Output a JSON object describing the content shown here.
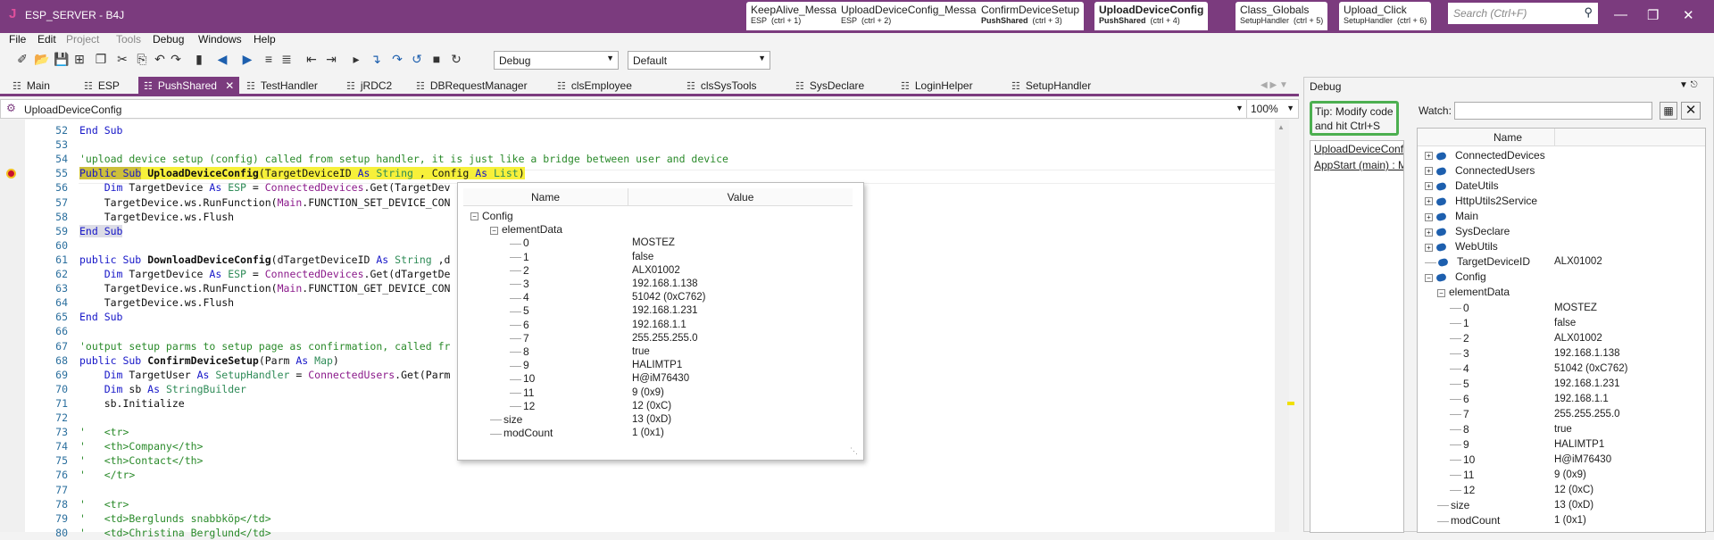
{
  "window": {
    "logo": "J",
    "title": "ESP_SERVER - B4J",
    "search_placeholder": "Search (Ctrl+F)"
  },
  "quick_tabs": [
    {
      "name": "KeepAlive_Message",
      "module": "ESP",
      "shortcut": "(ctrl + 1)"
    },
    {
      "name": "UploadDeviceConfig_Message",
      "module": "ESP",
      "shortcut": "(ctrl + 2)"
    },
    {
      "name": "ConfirmDeviceSetup",
      "module": "PushShared",
      "shortcut": "(ctrl + 3)"
    },
    {
      "name": "UploadDeviceConfig",
      "module": "PushShared",
      "shortcut": "(ctrl + 4)",
      "active": true
    },
    {
      "name": "Class_Globals",
      "module": "SetupHandler",
      "shortcut": "(ctrl + 5)"
    },
    {
      "name": "Upload_Click",
      "module": "SetupHandler",
      "shortcut": "(ctrl + 6)"
    }
  ],
  "menu": [
    "File",
    "Edit",
    "Project",
    "Tools",
    "Debug",
    "Windows",
    "Help"
  ],
  "toolbar": {
    "build_config": "Debug",
    "target": "Default"
  },
  "tabs": [
    "Main",
    "ESP",
    "PushShared",
    "TestHandler",
    "jRDC2",
    "DBRequestManager",
    "clsEmployee",
    "clsSysTools",
    "SysDeclare",
    "LoginHelper",
    "SetupHandler"
  ],
  "active_tab": "PushShared",
  "editor": {
    "sub_selector": "UploadDeviceConfig",
    "zoom": "100%"
  },
  "code": [
    {
      "n": "52",
      "t": [
        [
          "End Sub",
          "k"
        ]
      ]
    },
    {
      "n": "53",
      "t": []
    },
    {
      "n": "54",
      "t": [
        [
          "'upload device setup (config) called from setup handler, it is just like a bridge between user and device",
          "c"
        ]
      ]
    },
    {
      "n": "55",
      "bp": true,
      "t": [
        [
          "Public Sub",
          "k hlk"
        ],
        [
          " ",
          "hl"
        ],
        [
          "UploadDeviceConfig",
          "f hl"
        ],
        [
          "(TargetDeviceID ",
          "n hl"
        ],
        [
          "As",
          "k hl"
        ],
        [
          " ",
          "hl"
        ],
        [
          "String",
          "t hl"
        ],
        [
          " , Config ",
          "n hl"
        ],
        [
          "As",
          "k hl"
        ],
        [
          " ",
          "hl"
        ],
        [
          "List",
          "t hl"
        ],
        [
          ")",
          "n hl"
        ]
      ]
    },
    {
      "n": "56",
      "t": [
        [
          "    Dim",
          "k"
        ],
        [
          " TargetDevice ",
          "n"
        ],
        [
          "As",
          "k"
        ],
        [
          " ESP",
          "t"
        ],
        [
          " = ",
          "n"
        ],
        [
          "ConnectedDevices",
          "p"
        ],
        [
          ".Get(TargetDev",
          "n"
        ]
      ]
    },
    {
      "n": "57",
      "t": [
        [
          "    TargetDevice.ws.RunFunction(",
          "n"
        ],
        [
          "Main",
          "p"
        ],
        [
          ".FUNCTION_SET_DEVICE_CON",
          "n"
        ]
      ]
    },
    {
      "n": "58",
      "t": [
        [
          "    TargetDevice.ws.Flush",
          "n"
        ]
      ]
    },
    {
      "n": "59",
      "t": [
        [
          "End Sub",
          "k hle"
        ]
      ]
    },
    {
      "n": "60",
      "t": []
    },
    {
      "n": "61",
      "t": [
        [
          "public Sub",
          "k"
        ],
        [
          " ",
          "n"
        ],
        [
          "DownloadDeviceConfig",
          "f"
        ],
        [
          "(dTargetDeviceID ",
          "n"
        ],
        [
          "As",
          "k"
        ],
        [
          " String",
          "t"
        ],
        [
          " ,d",
          "n"
        ]
      ]
    },
    {
      "n": "62",
      "t": [
        [
          "    Dim",
          "k"
        ],
        [
          " TargetDevice ",
          "n"
        ],
        [
          "As",
          "k"
        ],
        [
          " ESP",
          "t"
        ],
        [
          " = ",
          "n"
        ],
        [
          "ConnectedDevices",
          "p"
        ],
        [
          ".Get(dTargetDe",
          "n"
        ]
      ]
    },
    {
      "n": "63",
      "t": [
        [
          "    TargetDevice.ws.RunFunction(",
          "n"
        ],
        [
          "Main",
          "p"
        ],
        [
          ".FUNCTION_GET_DEVICE_CON",
          "n"
        ]
      ]
    },
    {
      "n": "64",
      "t": [
        [
          "    TargetDevice.ws.Flush",
          "n"
        ]
      ]
    },
    {
      "n": "65",
      "t": [
        [
          "End Sub",
          "k"
        ]
      ]
    },
    {
      "n": "66",
      "t": []
    },
    {
      "n": "67",
      "t": [
        [
          "'output setup parms to setup page as confirmation, called fr",
          "c"
        ]
      ]
    },
    {
      "n": "68",
      "t": [
        [
          "public Sub",
          "k"
        ],
        [
          " ",
          "n"
        ],
        [
          "ConfirmDeviceSetup",
          "f"
        ],
        [
          "(Parm ",
          "n"
        ],
        [
          "As",
          "k"
        ],
        [
          " Map",
          "t"
        ],
        [
          ")",
          "n"
        ]
      ]
    },
    {
      "n": "69",
      "t": [
        [
          "    Dim",
          "k"
        ],
        [
          " TargetUser ",
          "n"
        ],
        [
          "As",
          "k"
        ],
        [
          " SetupHandler",
          "t"
        ],
        [
          " = ",
          "n"
        ],
        [
          "ConnectedUsers",
          "p"
        ],
        [
          ".Get(Parm",
          "n"
        ]
      ]
    },
    {
      "n": "70",
      "t": [
        [
          "    Dim",
          "k"
        ],
        [
          " sb ",
          "n"
        ],
        [
          "As",
          "k"
        ],
        [
          " StringBuilder",
          "t"
        ]
      ]
    },
    {
      "n": "71",
      "t": [
        [
          "    sb.Initialize",
          "n"
        ]
      ]
    },
    {
      "n": "72",
      "t": []
    },
    {
      "n": "73",
      "t": [
        [
          "'   <tr>",
          "c"
        ]
      ]
    },
    {
      "n": "74",
      "t": [
        [
          "'   <th>Company</th>",
          "c"
        ]
      ]
    },
    {
      "n": "75",
      "t": [
        [
          "'   <th>Contact</th>",
          "c"
        ]
      ]
    },
    {
      "n": "76",
      "t": [
        [
          "'   </tr>",
          "c"
        ]
      ]
    },
    {
      "n": "77",
      "t": []
    },
    {
      "n": "78",
      "t": [
        [
          "'   <tr>",
          "c"
        ]
      ]
    },
    {
      "n": "79",
      "t": [
        [
          "'   <td>Berglunds snabbköp</td>",
          "c"
        ]
      ]
    },
    {
      "n": "80",
      "t": [
        [
          "'   <td>Christina Berglund</td>",
          "c"
        ]
      ]
    }
  ],
  "popup": {
    "headers": [
      "Name",
      "Value"
    ],
    "rows": [
      {
        "name": "Config",
        "value": "",
        "level": 0,
        "exp": "-"
      },
      {
        "name": "elementData",
        "value": "",
        "level": 1,
        "exp": "-"
      },
      {
        "name": "0",
        "value": "MOSTEZ",
        "level": 2
      },
      {
        "name": "1",
        "value": "false",
        "level": 2
      },
      {
        "name": "2",
        "value": "ALX01002",
        "level": 2
      },
      {
        "name": "3",
        "value": "192.168.1.138",
        "level": 2
      },
      {
        "name": "4",
        "value": "51042 (0xC762)",
        "level": 2
      },
      {
        "name": "5",
        "value": "192.168.1.231",
        "level": 2
      },
      {
        "name": "6",
        "value": "192.168.1.1",
        "level": 2
      },
      {
        "name": "7",
        "value": "255.255.255.0",
        "level": 2
      },
      {
        "name": "8",
        "value": "true",
        "level": 2
      },
      {
        "name": "9",
        "value": "HALIMTP1",
        "level": 2
      },
      {
        "name": "10",
        "value": "H@iM76430",
        "level": 2
      },
      {
        "name": "11",
        "value": "9 (0x9)",
        "level": 2
      },
      {
        "name": "12",
        "value": "12 (0xC)",
        "level": 2
      },
      {
        "name": "size",
        "value": "13 (0xD)",
        "level": 1
      },
      {
        "name": "modCount",
        "value": "1 (0x1)",
        "level": 1
      }
    ]
  },
  "debug": {
    "title": "Debug",
    "tip": "Tip: Modify code and hit Ctrl+S",
    "watch_label": "Watch:",
    "watch_value": "",
    "stack": [
      "UploadDeviceConfig",
      "AppStart (main) : Main"
    ],
    "tree_header": "Name",
    "tree": [
      {
        "name": "ConnectedDevices",
        "value": "",
        "level": 0,
        "exp": "+",
        "obj": true
      },
      {
        "name": "ConnectedUsers",
        "value": "",
        "level": 0,
        "exp": "+",
        "obj": true
      },
      {
        "name": "DateUtils",
        "value": "",
        "level": 0,
        "exp": "+",
        "obj": true
      },
      {
        "name": "HttpUtils2Service",
        "value": "",
        "level": 0,
        "exp": "+",
        "obj": true
      },
      {
        "name": "Main",
        "value": "",
        "level": 0,
        "exp": "+",
        "obj": true
      },
      {
        "name": "SysDeclare",
        "value": "",
        "level": 0,
        "exp": "+",
        "obj": true
      },
      {
        "name": "WebUtils",
        "value": "",
        "level": 0,
        "exp": "+",
        "obj": true
      },
      {
        "name": "TargetDeviceID",
        "value": "ALX01002",
        "level": 0,
        "obj": true
      },
      {
        "name": "Config",
        "value": "",
        "level": 0,
        "exp": "-",
        "obj": true
      },
      {
        "name": "elementData",
        "value": "",
        "level": 1,
        "exp": "-"
      },
      {
        "name": "0",
        "value": "MOSTEZ",
        "level": 2
      },
      {
        "name": "1",
        "value": "false",
        "level": 2
      },
      {
        "name": "2",
        "value": "ALX01002",
        "level": 2
      },
      {
        "name": "3",
        "value": "192.168.1.138",
        "level": 2
      },
      {
        "name": "4",
        "value": "51042 (0xC762)",
        "level": 2
      },
      {
        "name": "5",
        "value": "192.168.1.231",
        "level": 2
      },
      {
        "name": "6",
        "value": "192.168.1.1",
        "level": 2
      },
      {
        "name": "7",
        "value": "255.255.255.0",
        "level": 2
      },
      {
        "name": "8",
        "value": "true",
        "level": 2
      },
      {
        "name": "9",
        "value": "HALIMTP1",
        "level": 2
      },
      {
        "name": "10",
        "value": "H@iM76430",
        "level": 2
      },
      {
        "name": "11",
        "value": "9 (0x9)",
        "level": 2
      },
      {
        "name": "12",
        "value": "12 (0xC)",
        "level": 2
      },
      {
        "name": "size",
        "value": "13 (0xD)",
        "level": 1
      },
      {
        "name": "modCount",
        "value": "1 (0x1)",
        "level": 1
      }
    ]
  },
  "colors": {
    "title_bar": "#7b3b7e",
    "tip_border": "#4caf50",
    "current_line": "#f7f03a"
  }
}
